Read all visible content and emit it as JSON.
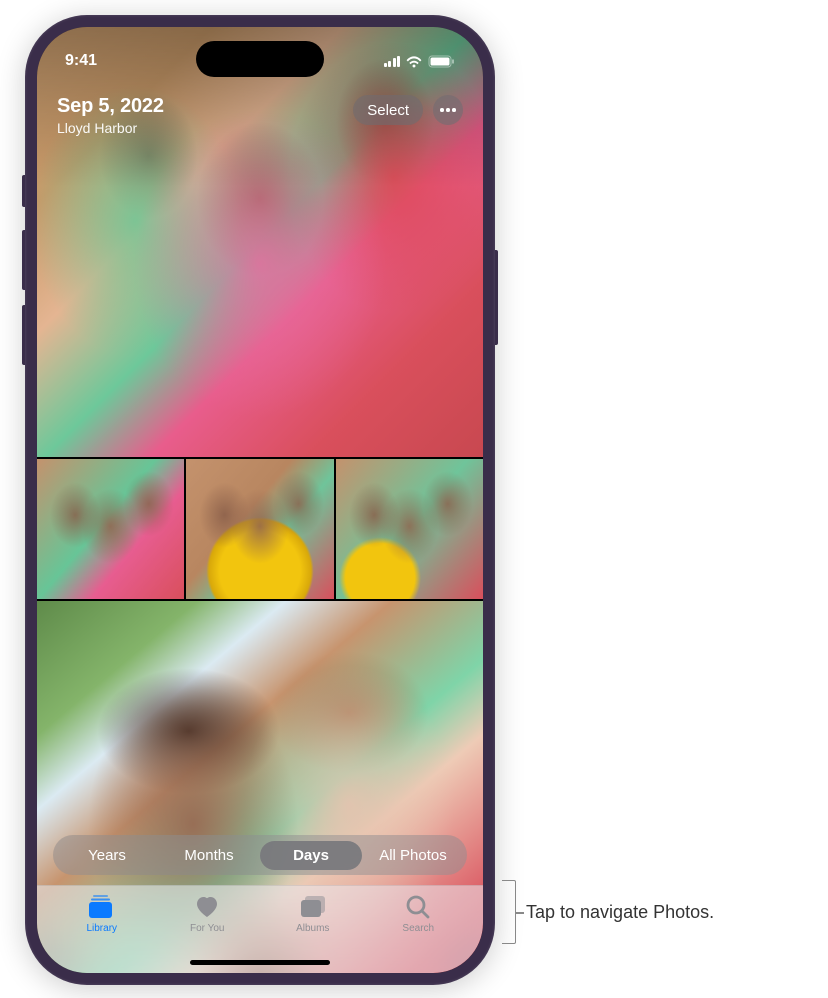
{
  "status_bar": {
    "time": "9:41"
  },
  "header": {
    "date": "Sep 5, 2022",
    "location": "Lloyd Harbor",
    "select_label": "Select"
  },
  "segments": {
    "years": "Years",
    "months": "Months",
    "days": "Days",
    "all": "All Photos",
    "active": "days"
  },
  "tabs": {
    "library": "Library",
    "foryou": "For You",
    "albums": "Albums",
    "search": "Search",
    "active": "library"
  },
  "callout": {
    "text": "Tap to navigate Photos."
  }
}
